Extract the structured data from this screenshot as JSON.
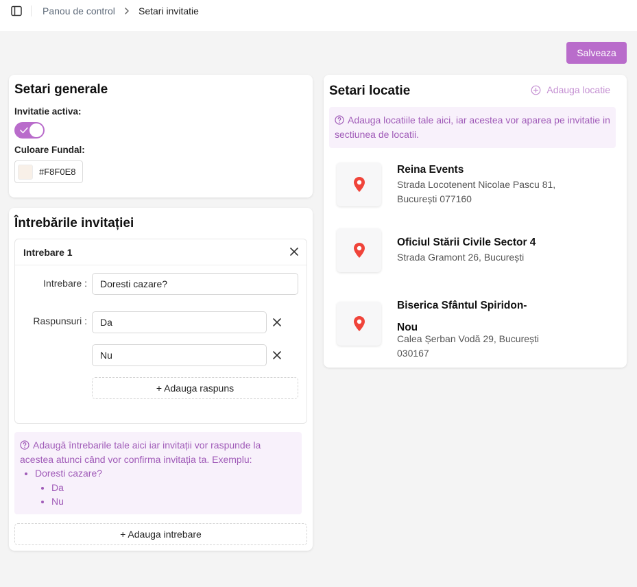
{
  "topbar": {
    "toggle_icon": "sidebar-toggle-icon",
    "breadcrumb_parent": "Panou de control",
    "breadcrumb_current": "Setari invitatie"
  },
  "actions": {
    "save_label": "Salveaza",
    "accent_color": "#b96ccb"
  },
  "general": {
    "title": "Setari generale",
    "active_label": "Invitatie activa",
    "active_value": true,
    "bg_color_label": "Culoare Fundal",
    "bg_color_value": "#F8F0E8"
  },
  "questions": {
    "title": "Întrebările invitației",
    "items": [
      {
        "header": "Intrebare 1",
        "question_label": "Intrebare",
        "question_value": "Doresti cazare?",
        "answers_label": "Raspunsuri",
        "answers": [
          "Da",
          "Nu"
        ],
        "add_answer_label": "+ Adauga raspuns"
      }
    ],
    "info_text": "Adaugă întrebarile tale aici iar invitații vor raspunde la acestea atunci când vor confirma invitația ta. Exemplu:",
    "info_example_question": "Doresti cazare?",
    "info_example_answers": [
      "Da",
      "Nu"
    ],
    "add_question_label": "+ Adauga intrebare"
  },
  "location": {
    "title": "Setari locatie",
    "add_label": "Adauga locatie",
    "info_text": "Adauga locatiile tale aici, iar acestea vor aparea pe invitatie in sectiunea de locatii.",
    "items": [
      {
        "name": "Reina Events",
        "address": "Strada Locotenent Nicolae Pascu 81, București 077160"
      },
      {
        "name": "Oficiul Stării Civile Sector 4",
        "address": "Strada Gramont 26, București"
      },
      {
        "name": "Biserica Sfântul Spiridon-Nou",
        "address": "Calea Șerban Vodă 29, București 030167"
      }
    ],
    "pin_color": "#f0443a"
  }
}
